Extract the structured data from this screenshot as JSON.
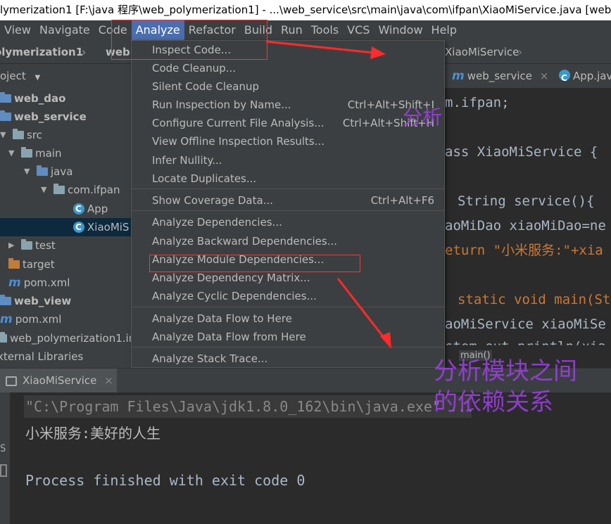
{
  "window_title": "lymerization1 [F:\\java 程序\\web_polymerization1] - ...\\web_service\\src\\main\\java\\com\\ifpan\\XiaoMiService.java [web_ser",
  "menubar": [
    {
      "label": "View"
    },
    {
      "label": "Navigate"
    },
    {
      "label": "Code"
    },
    {
      "label": "Analyze"
    },
    {
      "label": "Refactor"
    },
    {
      "label": "Build"
    },
    {
      "label": "Run"
    },
    {
      "label": "Tools"
    },
    {
      "label": "VCS"
    },
    {
      "label": "Window"
    },
    {
      "label": "Help"
    }
  ],
  "breadcrumb": {
    "project": "olymerization1",
    "module": "web",
    "file": "XiaoMiService"
  },
  "project_panel": {
    "header": "oject",
    "items": [
      {
        "label": "web_dao"
      },
      {
        "label": "web_service"
      },
      {
        "label": "src"
      },
      {
        "label": "main"
      },
      {
        "label": "java"
      },
      {
        "label": "com.ifpan"
      },
      {
        "label": "App"
      },
      {
        "label": "XiaoMiS"
      },
      {
        "label": "test"
      },
      {
        "label": "target"
      },
      {
        "label": "pom.xml"
      },
      {
        "label": "web_view"
      },
      {
        "label": "pom.xml"
      },
      {
        "label": "web_polymerization1.in"
      },
      {
        "label": "xternal Libraries"
      }
    ]
  },
  "editor_tabs": [
    {
      "label": "web_service"
    },
    {
      "label": "App.jav"
    }
  ],
  "code_lines": [
    "m.ifpan;",
    "ass XiaoMiService {",
    "String service(){",
    "aoMiDao xiaoMiDao=ne",
    "eturn \"小米服务:\"+xia",
    "static void main(St",
    "aoMiService xiaoMiSe",
    "stem.out.println(xia"
  ],
  "editor_hint": "main()",
  "analyze_menu": {
    "items": [
      {
        "label": "Inspect Code...",
        "shortcut": ""
      },
      {
        "label": "Code Cleanup...",
        "shortcut": ""
      },
      {
        "label": "Silent Code Cleanup",
        "shortcut": ""
      },
      {
        "label": "Run Inspection by Name...",
        "shortcut": "Ctrl+Alt+Shift+I"
      },
      {
        "label": "Configure Current File Analysis...",
        "shortcut": "Ctrl+Alt+Shift+H"
      },
      {
        "label": "View Offline Inspection Results...",
        "shortcut": ""
      },
      {
        "label": "Infer Nullity...",
        "shortcut": ""
      },
      {
        "label": "Locate Duplicates...",
        "shortcut": ""
      },
      {
        "label": "Show Coverage Data...",
        "shortcut": "Ctrl+Alt+F6"
      },
      {
        "label": "Analyze Dependencies...",
        "shortcut": ""
      },
      {
        "label": "Analyze Backward Dependencies...",
        "shortcut": ""
      },
      {
        "label": "Analyze Module Dependencies...",
        "shortcut": ""
      },
      {
        "label": "Analyze Dependency Matrix...",
        "shortcut": ""
      },
      {
        "label": "Analyze Cyclic Dependencies...",
        "shortcut": ""
      },
      {
        "label": "Analyze Data Flow to Here",
        "shortcut": ""
      },
      {
        "label": "Analyze Data Flow from Here",
        "shortcut": ""
      },
      {
        "label": "Analyze Stack Trace...",
        "shortcut": ""
      }
    ]
  },
  "run_tab": {
    "label": "XiaoMiService"
  },
  "console": {
    "command": "\"C:\\Program Files\\Java\\jdk1.8.0_162\\bin\\java.exe\" ...",
    "output": "小米服务:美好的人生",
    "finish": "Process finished with exit code 0"
  },
  "annotations": {
    "analyze": "分析",
    "module_line1": "分析模块之间",
    "module_line2": "的依赖关系"
  },
  "colors": {
    "accent": "#4b6eaf",
    "annotation": "#a040e8",
    "highlight_box": "#ff3333"
  }
}
